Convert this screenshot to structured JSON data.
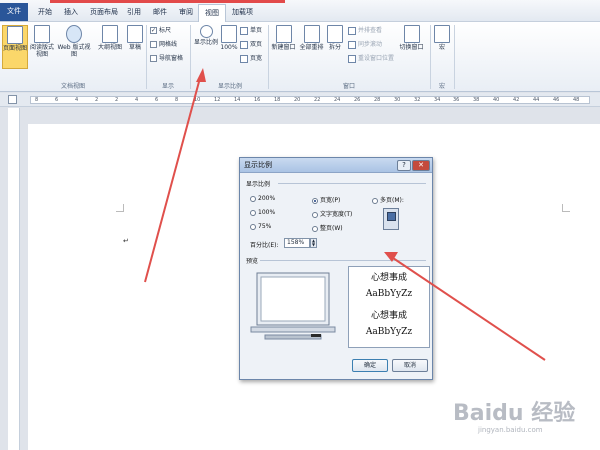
{
  "ribbon": {
    "tabs": [
      "文件",
      "开始",
      "插入",
      "页面布局",
      "引用",
      "邮件",
      "审阅",
      "视图",
      "加载项"
    ],
    "active_tab": "视图",
    "groups": {
      "document_views": {
        "label": "文档视图",
        "buttons": [
          "页面视图",
          "阅读版式视图",
          "Web 版式视图",
          "大纲视图",
          "草稿"
        ]
      },
      "show": {
        "label": "显示",
        "items": [
          {
            "label": "标尺",
            "checked": true
          },
          {
            "label": "网格线",
            "checked": false
          },
          {
            "label": "导航窗格",
            "checked": false
          }
        ]
      },
      "zoom": {
        "label": "显示比例",
        "zoom_button": "显示比例",
        "pct_button": "100%",
        "options": [
          "单页",
          "双页",
          "页宽"
        ]
      },
      "window": {
        "label": "窗口",
        "buttons": [
          "新建窗口",
          "全部重排",
          "拆分"
        ],
        "side_items": [
          "并排查看",
          "同步滚动",
          "重设窗口位置"
        ],
        "switch_button": "切换窗口"
      },
      "macros": {
        "label": "宏",
        "button": "宏"
      }
    }
  },
  "ruler": {
    "numbers": [
      "8",
      "6",
      "4",
      "2",
      "2",
      "4",
      "6",
      "8",
      "10",
      "12",
      "14",
      "16",
      "18",
      "20",
      "22",
      "24",
      "26",
      "28",
      "30",
      "32",
      "34",
      "36",
      "38",
      "40",
      "42",
      "44",
      "46",
      "48"
    ]
  },
  "document": {
    "paragraph_mark": "↵"
  },
  "dialog": {
    "title": "显示比例",
    "help": "?",
    "close": "✕",
    "zoom_section": "显示比例",
    "options_col1": [
      {
        "label": "200%",
        "selected": false
      },
      {
        "label": "100%",
        "selected": false
      },
      {
        "label": "75%",
        "selected": false
      }
    ],
    "options_col2": [
      {
        "label": "页宽(P)",
        "selected": true
      },
      {
        "label": "文字宽度(T)",
        "selected": false
      },
      {
        "label": "整页(W)",
        "selected": false
      }
    ],
    "multi_page": "多页(M):",
    "percent_label": "百分比(E):",
    "percent_value": "158%",
    "preview_section": "预览",
    "preview_lines": [
      "心想事成",
      "AaBbYyZz",
      "心想事成",
      "AaBbYyZz"
    ],
    "ok": "确定",
    "cancel": "取消"
  },
  "watermark": {
    "main": "Baidu 经验",
    "sub": "jingyan.baidu.com"
  },
  "colors": {
    "file_tab": "#2a5699",
    "arrow": "#e0504c",
    "selected_button": "#fbd76a"
  }
}
